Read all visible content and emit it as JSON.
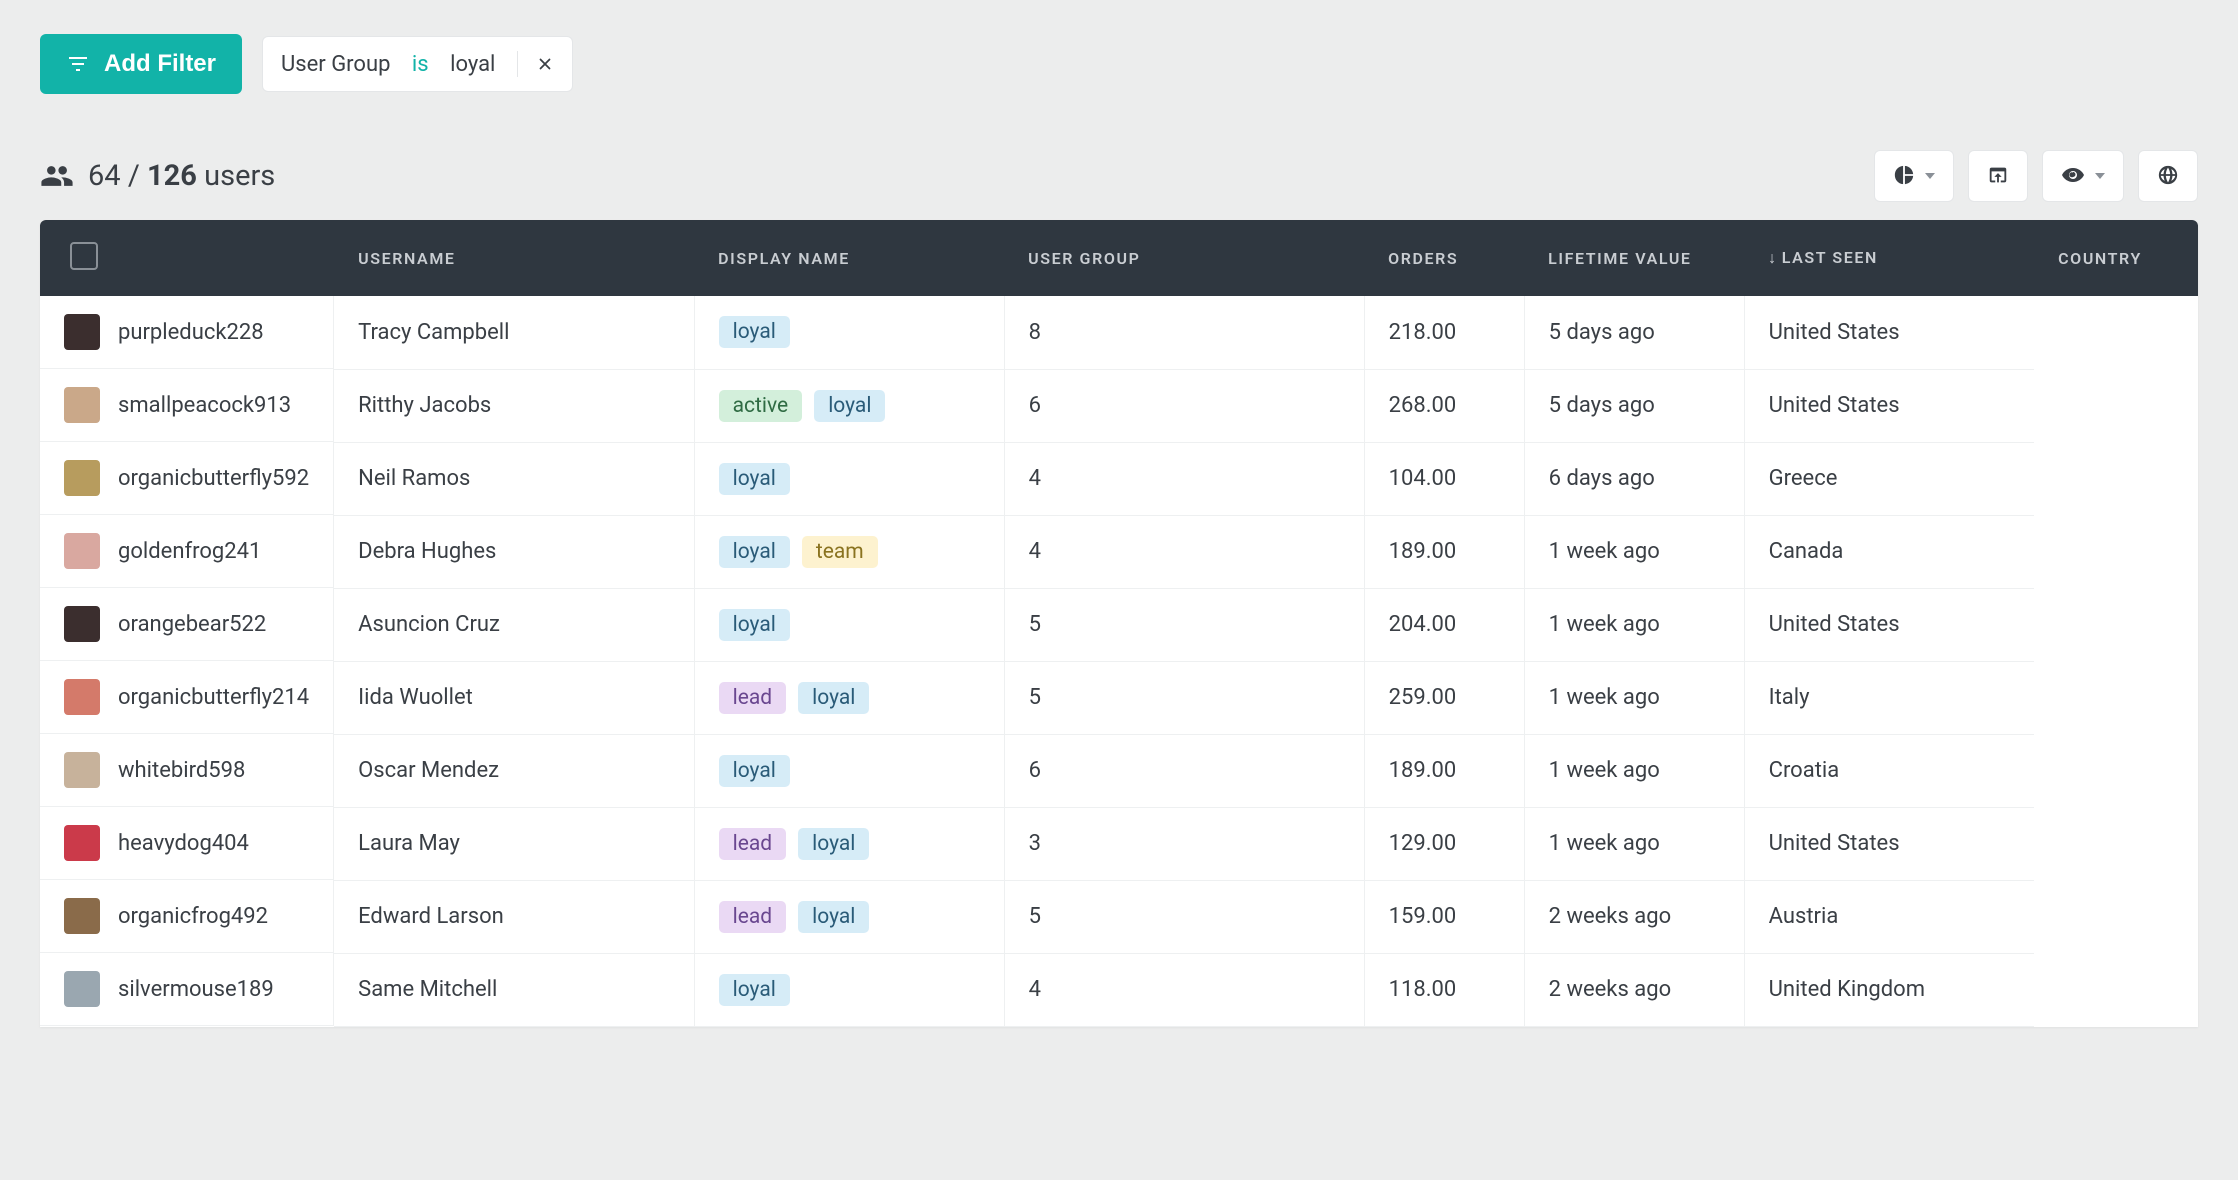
{
  "toolbar": {
    "add_filter_label": "Add Filter"
  },
  "filter_chip": {
    "field": "User Group",
    "operator": "is",
    "value": "loyal"
  },
  "summary": {
    "shown": "64",
    "separator": "/",
    "total": "126",
    "noun": "users"
  },
  "columns": {
    "username": "USERNAME",
    "display_name": "DISPLAY NAME",
    "user_group": "USER GROUP",
    "orders": "ORDERS",
    "lifetime_value": "LIFETIME VALUE",
    "last_seen": "LAST SEEN",
    "country": "COUNTRY",
    "sort_indicator": "↓"
  },
  "tag_labels": {
    "loyal": "loyal",
    "active": "active",
    "team": "team",
    "lead": "lead"
  },
  "rows": [
    {
      "username": "purpleduck228",
      "display_name": "Tracy Campbell",
      "groups": [
        "loyal"
      ],
      "orders": "8",
      "ltv": "218.00",
      "last_seen": "5 days ago",
      "country": "United States"
    },
    {
      "username": "smallpeacock913",
      "display_name": "Ritthy Jacobs",
      "groups": [
        "active",
        "loyal"
      ],
      "orders": "6",
      "ltv": "268.00",
      "last_seen": "5 days ago",
      "country": "United States"
    },
    {
      "username": "organicbutterfly592",
      "display_name": "Neil Ramos",
      "groups": [
        "loyal"
      ],
      "orders": "4",
      "ltv": "104.00",
      "last_seen": "6 days ago",
      "country": "Greece"
    },
    {
      "username": "goldenfrog241",
      "display_name": "Debra Hughes",
      "groups": [
        "loyal",
        "team"
      ],
      "orders": "4",
      "ltv": "189.00",
      "last_seen": "1 week ago",
      "country": "Canada"
    },
    {
      "username": "orangebear522",
      "display_name": "Asuncion Cruz",
      "groups": [
        "loyal"
      ],
      "orders": "5",
      "ltv": "204.00",
      "last_seen": "1 week ago",
      "country": "United States"
    },
    {
      "username": "organicbutterfly214",
      "display_name": "Iida Wuollet",
      "groups": [
        "lead",
        "loyal"
      ],
      "orders": "5",
      "ltv": "259.00",
      "last_seen": "1 week ago",
      "country": "Italy"
    },
    {
      "username": "whitebird598",
      "display_name": "Oscar Mendez",
      "groups": [
        "loyal"
      ],
      "orders": "6",
      "ltv": "189.00",
      "last_seen": "1 week ago",
      "country": "Croatia"
    },
    {
      "username": "heavydog404",
      "display_name": "Laura May",
      "groups": [
        "lead",
        "loyal"
      ],
      "orders": "3",
      "ltv": "129.00",
      "last_seen": "1 week ago",
      "country": "United States"
    },
    {
      "username": "organicfrog492",
      "display_name": "Edward Larson",
      "groups": [
        "lead",
        "loyal"
      ],
      "orders": "5",
      "ltv": "159.00",
      "last_seen": "2 weeks ago",
      "country": "Austria"
    },
    {
      "username": "silvermouse189",
      "display_name": "Same Mitchell",
      "groups": [
        "loyal"
      ],
      "orders": "4",
      "ltv": "118.00",
      "last_seen": "2 weeks ago",
      "country": "United Kingdom"
    }
  ],
  "avatar_colors": [
    "#3b2e2e",
    "#caa889",
    "#b79c5e",
    "#d9a8a0",
    "#3b2e2e",
    "#d47a6a",
    "#c7b29b",
    "#cb3a4a",
    "#8a6b4a",
    "#9aa7b0"
  ]
}
